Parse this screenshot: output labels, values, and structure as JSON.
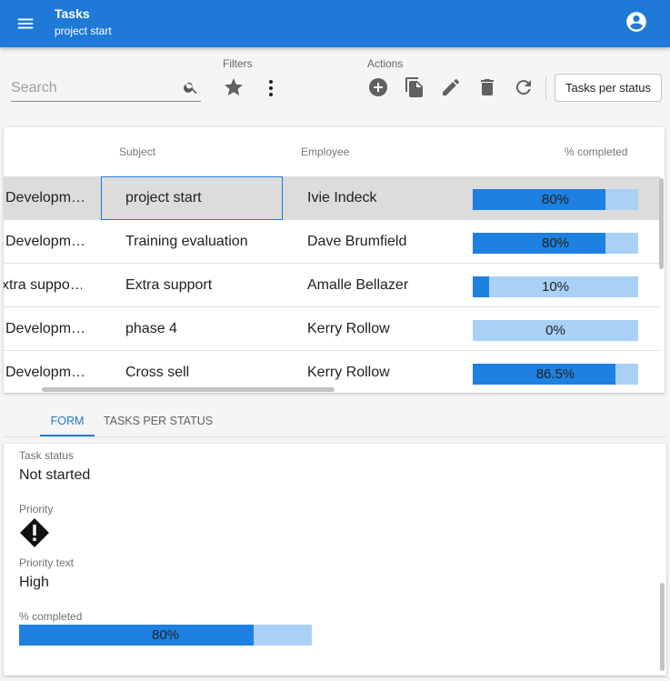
{
  "app": {
    "title": "Tasks",
    "subtitle": "project start"
  },
  "toolbar": {
    "search_placeholder": "Search",
    "filters_label": "Filters",
    "actions_label": "Actions",
    "tasks_per_status_button": "Tasks per status"
  },
  "grid": {
    "headers": {
      "project": "",
      "subject": "Subject",
      "employee": "Employee",
      "completed": "% completed"
    },
    "rows": [
      {
        "project": "Developm…",
        "subject": "project start",
        "employee": "Ivie Indeck",
        "completed": 80,
        "completed_label": "80%",
        "selected": true
      },
      {
        "project": "Developm…",
        "subject": "Training evaluation",
        "employee": "Dave Brumfield",
        "completed": 80,
        "completed_label": "80%"
      },
      {
        "project": "xtra suppo…",
        "subject": "Extra support",
        "employee": "Amalle Bellazer",
        "completed": 10,
        "completed_label": "10%"
      },
      {
        "project": "Developm…",
        "subject": "phase 4",
        "employee": "Kerry Rollow",
        "completed": 0,
        "completed_label": "0%"
      },
      {
        "project": "Developm…",
        "subject": "Cross sell",
        "employee": "Kerry Rollow",
        "completed": 86.5,
        "completed_label": "86.5%"
      }
    ]
  },
  "tabs": [
    {
      "label": "FORM",
      "active": true
    },
    {
      "label": "TASKS PER STATUS",
      "active": false
    }
  ],
  "form": {
    "task_status_label": "Task status",
    "task_status_value": "Not started",
    "priority_label": "Priority",
    "priority_icon": "priority-high-diamond-icon",
    "priority_text_label": "Priority text",
    "priority_text_value": "High",
    "completed_label": "% completed",
    "completed_value": 80,
    "completed_text": "80%"
  },
  "colors": {
    "primary": "#1e7ad6",
    "progress_fill": "#1e80e0",
    "progress_track": "#a9d0f7",
    "selected_row": "#dcdcdc"
  }
}
